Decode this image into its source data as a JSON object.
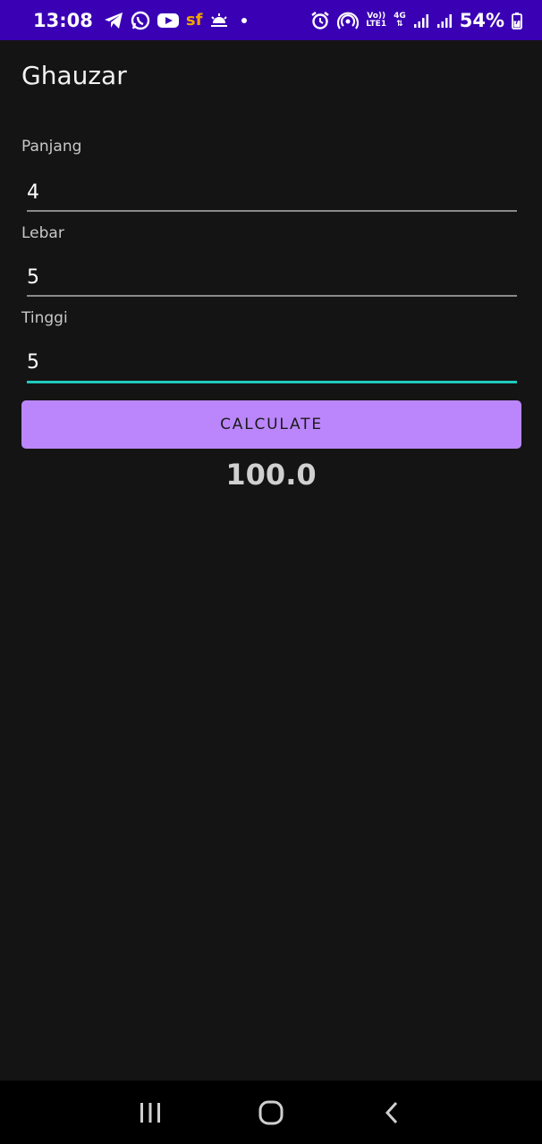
{
  "status_bar": {
    "time": "13:08",
    "left_icons": [
      "telegram-icon",
      "whatsapp-icon",
      "youtube-icon",
      "sf-icon",
      "weather-icon"
    ],
    "sf_text": "sf",
    "right_icons": [
      "alarm-icon",
      "hotspot-icon",
      "volte-icon",
      "4g-icon",
      "signal-icon",
      "signal-icon",
      "battery-charging-icon"
    ],
    "volte_line1": "Vo))",
    "volte_line2": "LTE1",
    "net_type": "4G",
    "battery": "54%"
  },
  "app": {
    "title": "Ghauzar"
  },
  "form": {
    "panjang": {
      "label": "Panjang",
      "value": "4"
    },
    "lebar": {
      "label": "Lebar",
      "value": "5"
    },
    "tinggi": {
      "label": "Tinggi",
      "value": "5"
    }
  },
  "calculate_label": "CALCULATE",
  "result": "100.0",
  "nav_bar": {
    "icons": [
      "recent-apps-icon",
      "home-icon",
      "back-icon"
    ]
  },
  "colors": {
    "status_bar": "#3a00b4",
    "background": "#141414",
    "button": "#bb86fc",
    "active_underline": "#1fc9bd"
  }
}
